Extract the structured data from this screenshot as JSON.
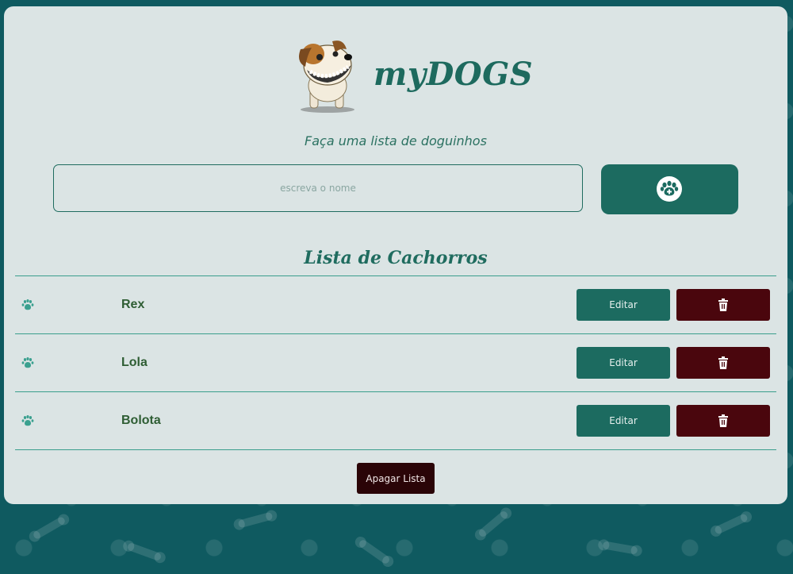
{
  "header": {
    "brand": "myDOGS",
    "subtitle": "Faça uma lista de doguinhos"
  },
  "form": {
    "input_placeholder": "escreva o nome",
    "input_value": "",
    "add_icon": "paw-plus-icon"
  },
  "list": {
    "title": "Lista de Cachorros",
    "items": [
      {
        "name": "Rex",
        "edit_label": "Editar",
        "delete_icon": "trash-icon"
      },
      {
        "name": "Lola",
        "edit_label": "Editar",
        "delete_icon": "trash-icon"
      },
      {
        "name": "Bolota",
        "edit_label": "Editar",
        "delete_icon": "trash-icon"
      }
    ]
  },
  "footer": {
    "clear_label": "Apagar Lista"
  },
  "colors": {
    "primary": "#1c6b60",
    "danger": "#4a060d",
    "clear": "#2a0407",
    "card": "#dbe4e4",
    "background": "#0f5a60"
  }
}
